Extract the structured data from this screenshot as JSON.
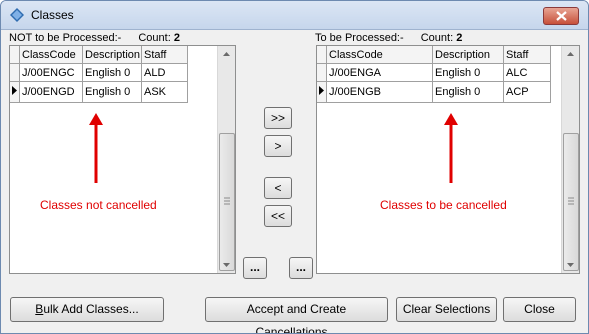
{
  "window": {
    "title": "Classes"
  },
  "left_panel": {
    "label": "NOT to be Processed:-",
    "count_label": "Count:",
    "count_value": "2",
    "columns": [
      "ClassCode",
      "Description",
      "Staff"
    ],
    "rows": [
      {
        "code": "J/00ENGC",
        "description": "English 0",
        "staff": "ALD",
        "current": false
      },
      {
        "code": "J/00ENGD",
        "description": "English 0",
        "staff": "ASK",
        "current": true
      }
    ],
    "annotation": "Classes not cancelled"
  },
  "right_panel": {
    "label": "To be Processed:-",
    "count_label": "Count:",
    "count_value": "2",
    "columns": [
      "ClassCode",
      "Description",
      "Staff"
    ],
    "rows": [
      {
        "code": "J/00ENGA",
        "description": "English 0",
        "staff": "ALC",
        "current": false
      },
      {
        "code": "J/00ENGB",
        "description": "English 0",
        "staff": "ACP",
        "current": true
      }
    ],
    "annotation": "Classes to be cancelled"
  },
  "transfer_buttons": {
    "move_all_right": ">>",
    "move_right": ">",
    "move_left": "<",
    "move_all_left": "<<",
    "left_more": "...",
    "right_more": "..."
  },
  "footer": {
    "bulk_add_label_prefix": "",
    "bulk_add_mnemonic": "B",
    "bulk_add_label_rest": "ulk Add Classes...",
    "accept_label": "Accept and Create Cancellations...",
    "clear_label": "Clear Selections",
    "close_label": "Close"
  },
  "colors": {
    "annotation": "#e00000",
    "title_bar": "#c6d6ec"
  }
}
